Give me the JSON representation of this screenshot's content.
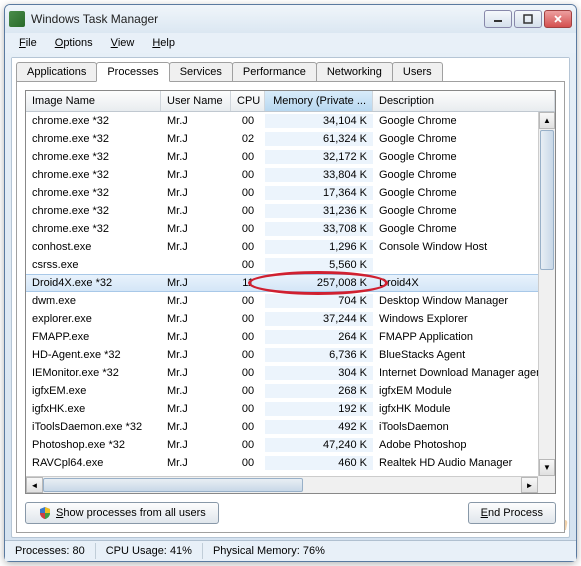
{
  "window": {
    "title": "Windows Task Manager"
  },
  "menu": {
    "file": "File",
    "options": "Options",
    "view": "View",
    "help": "Help"
  },
  "tabs": {
    "applications": "Applications",
    "processes": "Processes",
    "services": "Services",
    "performance": "Performance",
    "networking": "Networking",
    "users": "Users",
    "active": "processes"
  },
  "columns": {
    "name": "Image Name",
    "user": "User Name",
    "cpu": "CPU",
    "mem": "Memory (Private ...",
    "desc": "Description"
  },
  "rows": [
    {
      "name": "chrome.exe *32",
      "user": "Mr.J",
      "cpu": "00",
      "mem": "34,104 K",
      "desc": "Google Chrome"
    },
    {
      "name": "chrome.exe *32",
      "user": "Mr.J",
      "cpu": "02",
      "mem": "61,324 K",
      "desc": "Google Chrome"
    },
    {
      "name": "chrome.exe *32",
      "user": "Mr.J",
      "cpu": "00",
      "mem": "32,172 K",
      "desc": "Google Chrome"
    },
    {
      "name": "chrome.exe *32",
      "user": "Mr.J",
      "cpu": "00",
      "mem": "33,804 K",
      "desc": "Google Chrome"
    },
    {
      "name": "chrome.exe *32",
      "user": "Mr.J",
      "cpu": "00",
      "mem": "17,364 K",
      "desc": "Google Chrome"
    },
    {
      "name": "chrome.exe *32",
      "user": "Mr.J",
      "cpu": "00",
      "mem": "31,236 K",
      "desc": "Google Chrome"
    },
    {
      "name": "chrome.exe *32",
      "user": "Mr.J",
      "cpu": "00",
      "mem": "33,708 K",
      "desc": "Google Chrome"
    },
    {
      "name": "conhost.exe",
      "user": "Mr.J",
      "cpu": "00",
      "mem": "1,296 K",
      "desc": "Console Window Host"
    },
    {
      "name": "csrss.exe",
      "user": "",
      "cpu": "00",
      "mem": "5,560 K",
      "desc": ""
    },
    {
      "name": "Droid4X.exe *32",
      "user": "Mr.J",
      "cpu": "11",
      "mem": "257,008 K",
      "desc": "Droid4X",
      "selected": true
    },
    {
      "name": "dwm.exe",
      "user": "Mr.J",
      "cpu": "00",
      "mem": "704 K",
      "desc": "Desktop Window Manager"
    },
    {
      "name": "explorer.exe",
      "user": "Mr.J",
      "cpu": "00",
      "mem": "37,244 K",
      "desc": "Windows Explorer"
    },
    {
      "name": "FMAPP.exe",
      "user": "Mr.J",
      "cpu": "00",
      "mem": "264 K",
      "desc": "FMAPP Application"
    },
    {
      "name": "HD-Agent.exe *32",
      "user": "Mr.J",
      "cpu": "00",
      "mem": "6,736 K",
      "desc": "BlueStacks Agent"
    },
    {
      "name": "IEMonitor.exe *32",
      "user": "Mr.J",
      "cpu": "00",
      "mem": "304 K",
      "desc": "Internet Download Manager agen"
    },
    {
      "name": "igfxEM.exe",
      "user": "Mr.J",
      "cpu": "00",
      "mem": "268 K",
      "desc": "igfxEM Module"
    },
    {
      "name": "igfxHK.exe",
      "user": "Mr.J",
      "cpu": "00",
      "mem": "192 K",
      "desc": "igfxHK Module"
    },
    {
      "name": "iToolsDaemon.exe *32",
      "user": "Mr.J",
      "cpu": "00",
      "mem": "492 K",
      "desc": "iToolsDaemon"
    },
    {
      "name": "Photoshop.exe *32",
      "user": "Mr.J",
      "cpu": "00",
      "mem": "47,240 K",
      "desc": "Adobe Photoshop"
    },
    {
      "name": "RAVCpl64.exe",
      "user": "Mr.J",
      "cpu": "00",
      "mem": "460 K",
      "desc": "Realtek HD Audio Manager"
    }
  ],
  "buttons": {
    "show_all": "Show processes from all users",
    "end_process": "End Process"
  },
  "status": {
    "processes_label": "Processes:",
    "processes_value": "80",
    "cpu_label": "CPU Usage:",
    "cpu_value": "41%",
    "mem_label": "Physical Memory:",
    "mem_value": "76%"
  },
  "watermark": {
    "main": "Download",
    "tld": ".com.vn"
  }
}
